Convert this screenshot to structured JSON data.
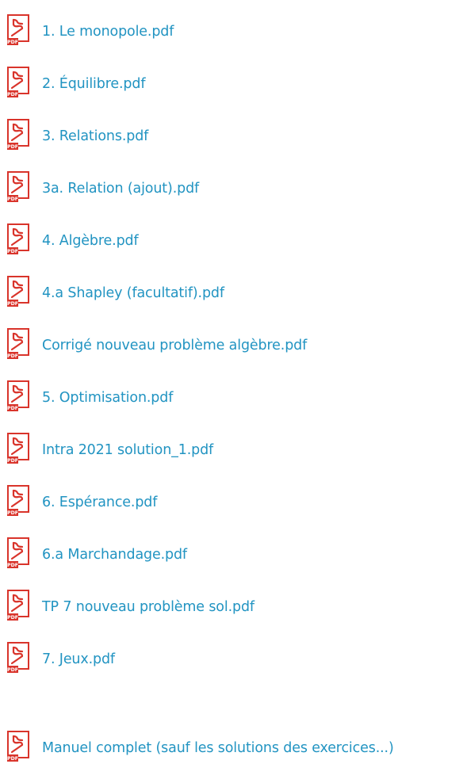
{
  "file_list": {
    "items": [
      {
        "icon": "pdf-file-icon",
        "label": "1. Le monopole.pdf"
      },
      {
        "icon": "pdf-file-icon",
        "label": "2. Équilibre.pdf"
      },
      {
        "icon": "pdf-file-icon",
        "label": "3. Relations.pdf"
      },
      {
        "icon": "pdf-file-icon",
        "label": "3a. Relation (ajout).pdf"
      },
      {
        "icon": "pdf-file-icon",
        "label": "4. Algèbre.pdf"
      },
      {
        "icon": "pdf-file-icon",
        "label": "4.a Shapley (facultatif).pdf"
      },
      {
        "icon": "pdf-file-icon",
        "label": "Corrigé nouveau problème algèbre.pdf"
      },
      {
        "icon": "pdf-file-icon",
        "label": "5. Optimisation.pdf"
      },
      {
        "icon": "pdf-file-icon",
        "label": "Intra 2021 solution_1.pdf"
      },
      {
        "icon": "pdf-file-icon",
        "label": "6. Espérance.pdf"
      },
      {
        "icon": "pdf-file-icon",
        "label": "6.a Marchandage.pdf"
      },
      {
        "icon": "pdf-file-icon",
        "label": "TP 7 nouveau problème sol.pdf"
      },
      {
        "icon": "pdf-file-icon",
        "label": "7. Jeux.pdf"
      },
      {
        "icon": "pdf-file-icon",
        "label": "Manuel complet (sauf les solutions des exercices...)"
      }
    ]
  },
  "colors": {
    "link": "#2294c2",
    "icon_red": "#d9342b",
    "background": "#ffffff"
  }
}
